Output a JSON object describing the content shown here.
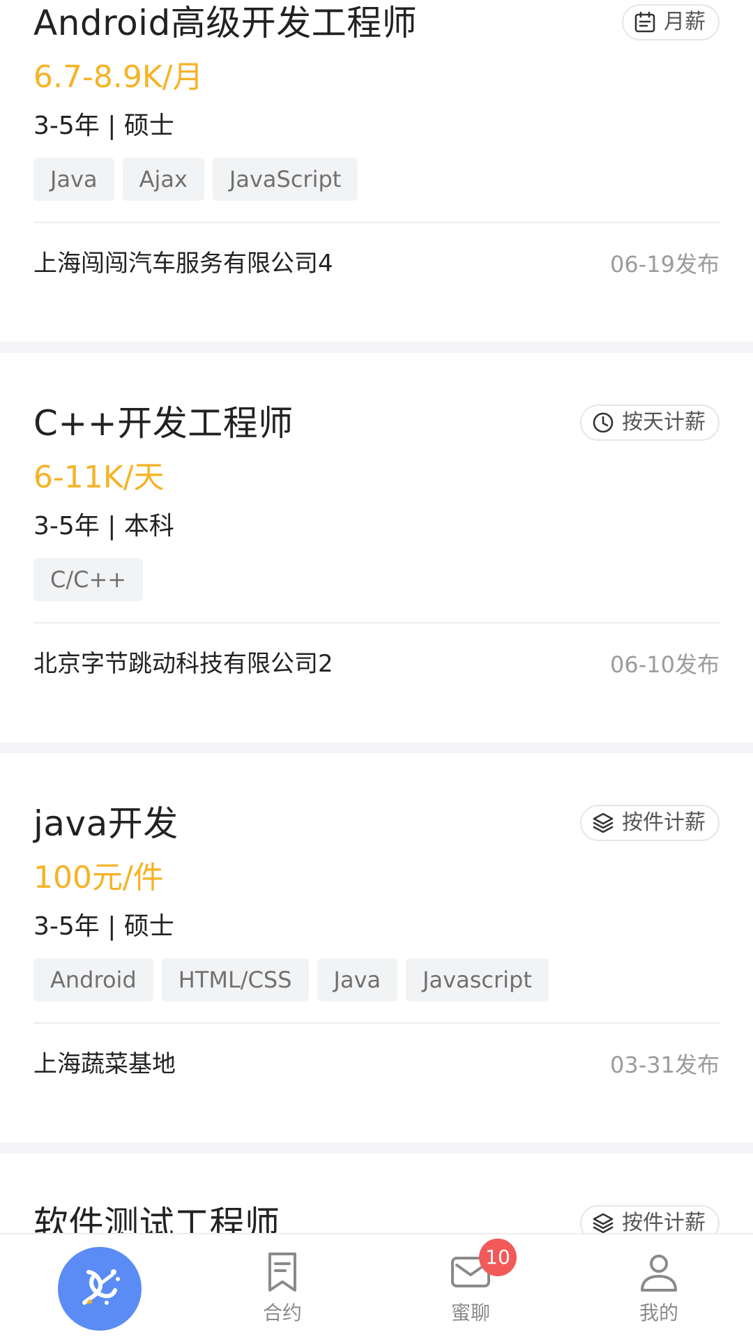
{
  "jobs": [
    {
      "title": "Android高级开发工程师",
      "pay_type": "月薪",
      "pay_type_icon": "calendar-icon",
      "salary": "6.7-8.9K/月",
      "requirements": "3-5年 | 硕士",
      "tags": [
        "Java",
        "Ajax",
        "JavaScript"
      ],
      "company": "上海闯闯汽车服务有限公司4",
      "posted": "06-19发布"
    },
    {
      "title": "C++开发工程师",
      "pay_type": "按天计薪",
      "pay_type_icon": "clock-icon",
      "salary": "6-11K/天",
      "requirements": "3-5年 | 本科",
      "tags": [
        "C/C++"
      ],
      "company": "北京字节跳动科技有限公司2",
      "posted": "06-10发布"
    },
    {
      "title": "java开发",
      "pay_type": "按件计薪",
      "pay_type_icon": "layers-icon",
      "salary": "100元/件",
      "requirements": "3-5年 | 硕士",
      "tags": [
        "Android",
        "HTML/CSS",
        "Java",
        "Javascript"
      ],
      "company": "上海蔬菜基地",
      "posted": "03-31发布"
    },
    {
      "title": "软件测试工程师",
      "pay_type": "按件计薪",
      "pay_type_icon": "layers-icon"
    }
  ],
  "bottom_nav": {
    "items": [
      {
        "id": "home",
        "label": "",
        "icon": "home-logo-icon",
        "active": true
      },
      {
        "id": "contract",
        "label": "合约",
        "icon": "contract-icon"
      },
      {
        "id": "chat",
        "label": "蜜聊",
        "icon": "mail-icon",
        "badge": "10"
      },
      {
        "id": "mine",
        "label": "我的",
        "icon": "user-icon"
      }
    ]
  },
  "colors": {
    "salary": "#F6B325",
    "accent": "#5B8CF5",
    "badge": "#F25A5A",
    "tag_bg": "#F2F3F5",
    "background": "#F5F5F7"
  }
}
